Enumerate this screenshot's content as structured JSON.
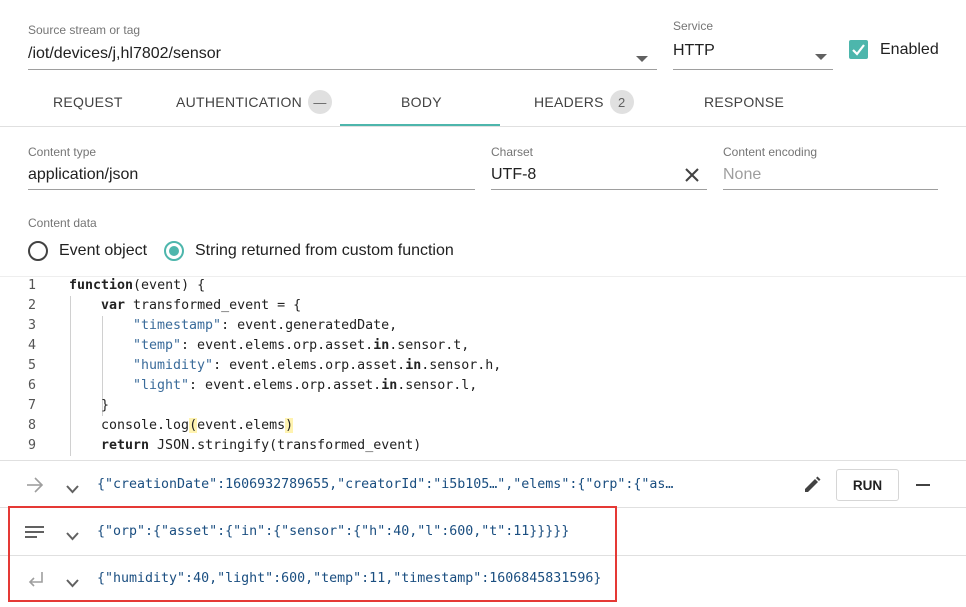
{
  "source": {
    "label": "Source stream or tag",
    "value": "/iot/devices/j,hl7802/sensor"
  },
  "service": {
    "label": "Service",
    "value": "HTTP"
  },
  "enabled": {
    "label": "Enabled",
    "checked": true
  },
  "tabs": [
    {
      "label": "REQUEST"
    },
    {
      "label": "AUTHENTICATION",
      "badge": "—"
    },
    {
      "label": "BODY",
      "active": true
    },
    {
      "label": "HEADERS",
      "badge": "2"
    },
    {
      "label": "RESPONSE"
    }
  ],
  "content_type": {
    "label": "Content type",
    "value": "application/json"
  },
  "charset": {
    "label": "Charset",
    "value": "UTF-8"
  },
  "content_encoding": {
    "label": "Content encoding",
    "placeholder": "None"
  },
  "content_data": {
    "label": "Content data",
    "options": [
      "Event object",
      "String returned from custom function"
    ],
    "selected": "String returned from custom function"
  },
  "code": {
    "line_numbers": [
      "1",
      "2",
      "3",
      "4",
      "5",
      "6",
      "7",
      "8",
      "9"
    ],
    "lines": [
      "function(event) {",
      "    var transformed_event = {",
      "        \"timestamp\": event.generatedDate,",
      "        \"temp\": event.elems.orp.asset.in.sensor.t,",
      "        \"humidity\": event.elems.orp.asset.in.sensor.h,",
      "        \"light\": event.elems.orp.asset.in.sensor.l,",
      "    }",
      "    console.log(event.elems)",
      "    return JSON.stringify(transformed_event)"
    ]
  },
  "results": {
    "input_row": "{\"creationDate\":1606932789655,\"creatorId\":\"i5b105…\",\"elems\":{\"orp\":{\"as…",
    "log_row": "{\"orp\":{\"asset\":{\"in\":{\"sensor\":{\"h\":40,\"l\":600,\"t\":11}}}}}",
    "output_row": "{\"humidity\":40,\"light\":600,\"temp\":11,\"timestamp\":1606845831596}",
    "run_label": "RUN"
  },
  "colors": {
    "accent": "#4db6ac",
    "highlight_box": "#e53935"
  },
  "icons": [
    "dropdown-arrow-icon",
    "checkbox-checked-icon",
    "clear-icon",
    "arrow-right-icon",
    "chevron-down-icon",
    "edit-icon",
    "minus-icon",
    "lines-icon",
    "return-arrow-icon"
  ]
}
